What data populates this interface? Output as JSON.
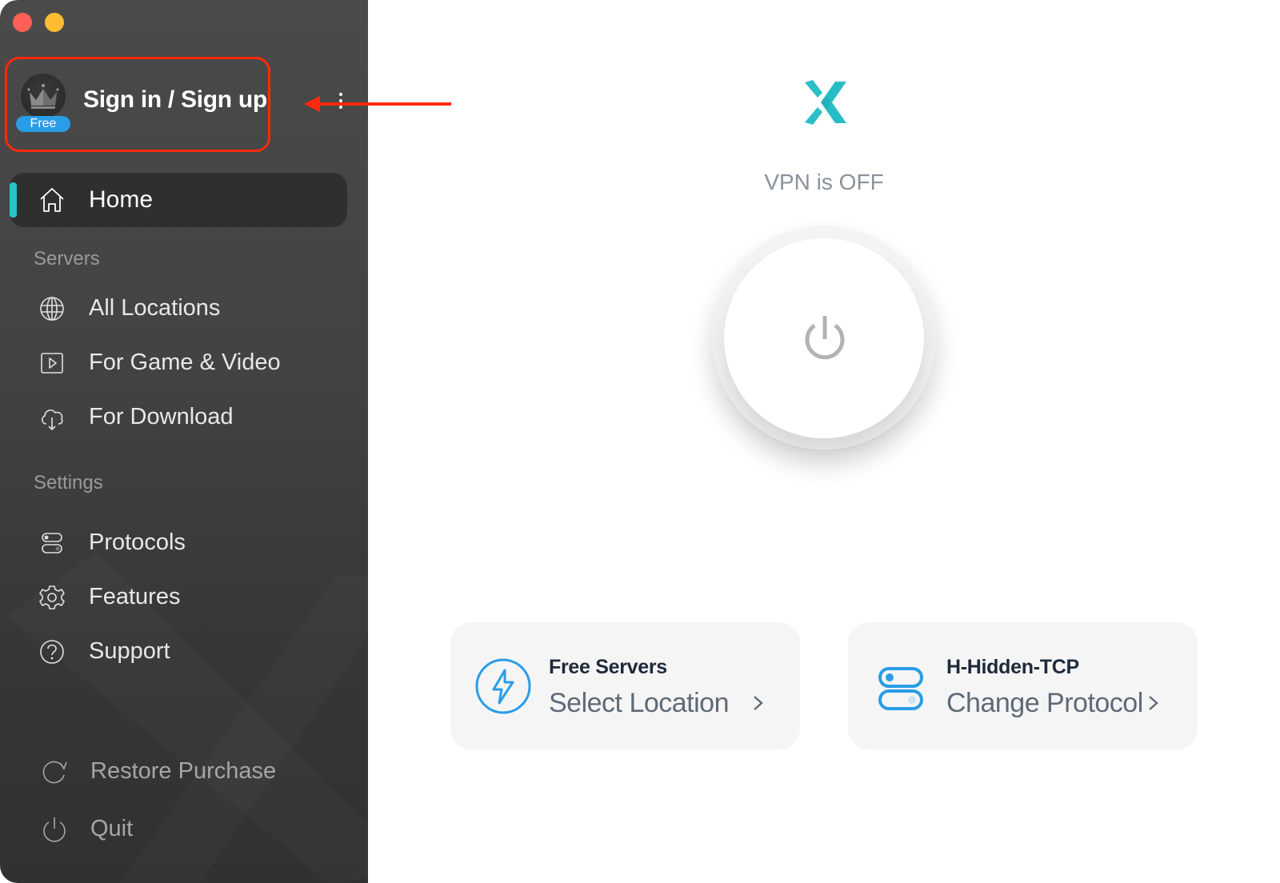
{
  "window": {
    "traffic_lights": [
      "close",
      "minimize"
    ]
  },
  "account": {
    "label": "Sign in / Sign up",
    "plan_badge": "Free",
    "avatar_icon": "crown-icon",
    "menu_icon": "kebab-menu-icon"
  },
  "annotation": {
    "box_color": "#ff2a0d",
    "arrow_color": "#ff2a0d"
  },
  "sidebar": {
    "home": {
      "label": "Home",
      "icon": "home-icon",
      "active": true
    },
    "servers_section": "Servers",
    "servers": [
      {
        "label": "All Locations",
        "icon": "globe-icon"
      },
      {
        "label": "For Game & Video",
        "icon": "play-icon"
      },
      {
        "label": "For Download",
        "icon": "cloud-download-icon"
      }
    ],
    "settings_section": "Settings",
    "settings": [
      {
        "label": "Protocols",
        "icon": "toggles-icon"
      },
      {
        "label": "Features",
        "icon": "gear-icon"
      },
      {
        "label": "Support",
        "icon": "help-icon"
      }
    ],
    "footer": [
      {
        "label": "Restore Purchase",
        "icon": "refresh-icon"
      },
      {
        "label": "Quit",
        "icon": "power-icon"
      }
    ]
  },
  "main": {
    "logo": "x-vpn-logo",
    "status": "VPN is OFF",
    "connect_button_icon": "power-icon",
    "cards": [
      {
        "title": "Free Servers",
        "subtitle": "Select Location",
        "icon": "lightning-icon"
      },
      {
        "title": "H-Hidden-TCP",
        "subtitle": "Change Protocol",
        "icon": "toggles-icon"
      }
    ]
  },
  "colors": {
    "accent_teal": "#27c4cc",
    "accent_blue": "#2a9de6",
    "sidebar_bg": "#434343",
    "card_bg": "#f5f5f6"
  }
}
